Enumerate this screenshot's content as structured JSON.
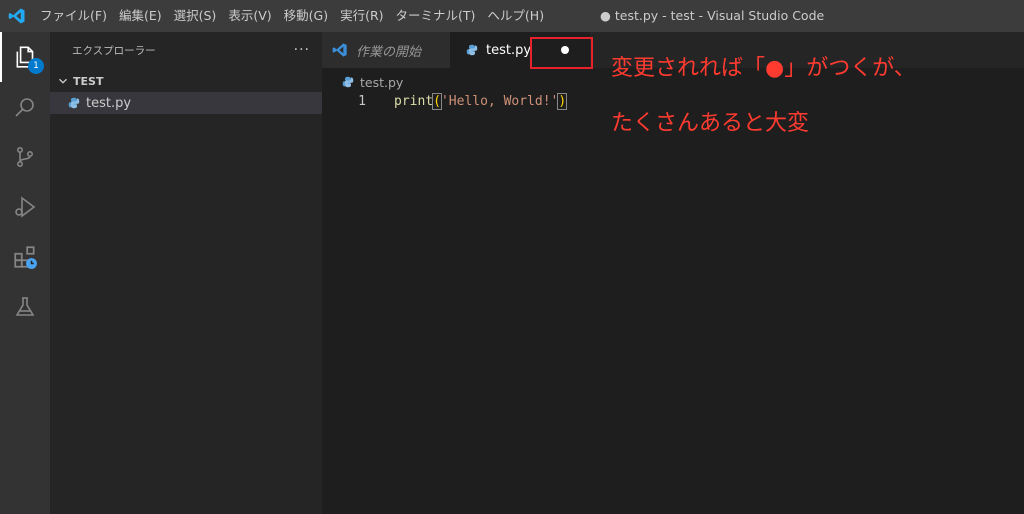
{
  "titlebar": {
    "menu": [
      "ファイル(F)",
      "編集(E)",
      "選択(S)",
      "表示(V)",
      "移動(G)",
      "実行(R)",
      "ターミナル(T)",
      "ヘルプ(H)"
    ],
    "window_title": "● test.py - test - Visual Studio Code"
  },
  "activitybar": {
    "explorer_badge": "1",
    "icons": [
      "explorer-icon",
      "search-icon",
      "source-control-icon",
      "run-debug-icon",
      "extensions-icon",
      "testing-icon"
    ]
  },
  "sidebar": {
    "title": "エクスプローラー",
    "more": "···",
    "folder": "TEST",
    "files": [
      {
        "name": "test.py"
      }
    ]
  },
  "editor": {
    "tabs": [
      {
        "label": "作業の開始",
        "active": false
      },
      {
        "label": "test.py",
        "active": true,
        "modified": true
      }
    ],
    "breadcrumb": "test.py",
    "lines": [
      {
        "number": "1",
        "fn": "print",
        "open": "(",
        "str": "'Hello, World!'",
        "close": ")"
      }
    ]
  },
  "annotation": {
    "line1": "変更されれば「●」がつくが、",
    "line2": "たくさんあると大変",
    "color": "#e8212b"
  },
  "colors": {
    "titlebar": "#3c3c3c",
    "activitybar": "#333333",
    "sidebar": "#252526",
    "editor": "#1e1e1e",
    "accent": "#007acc"
  }
}
